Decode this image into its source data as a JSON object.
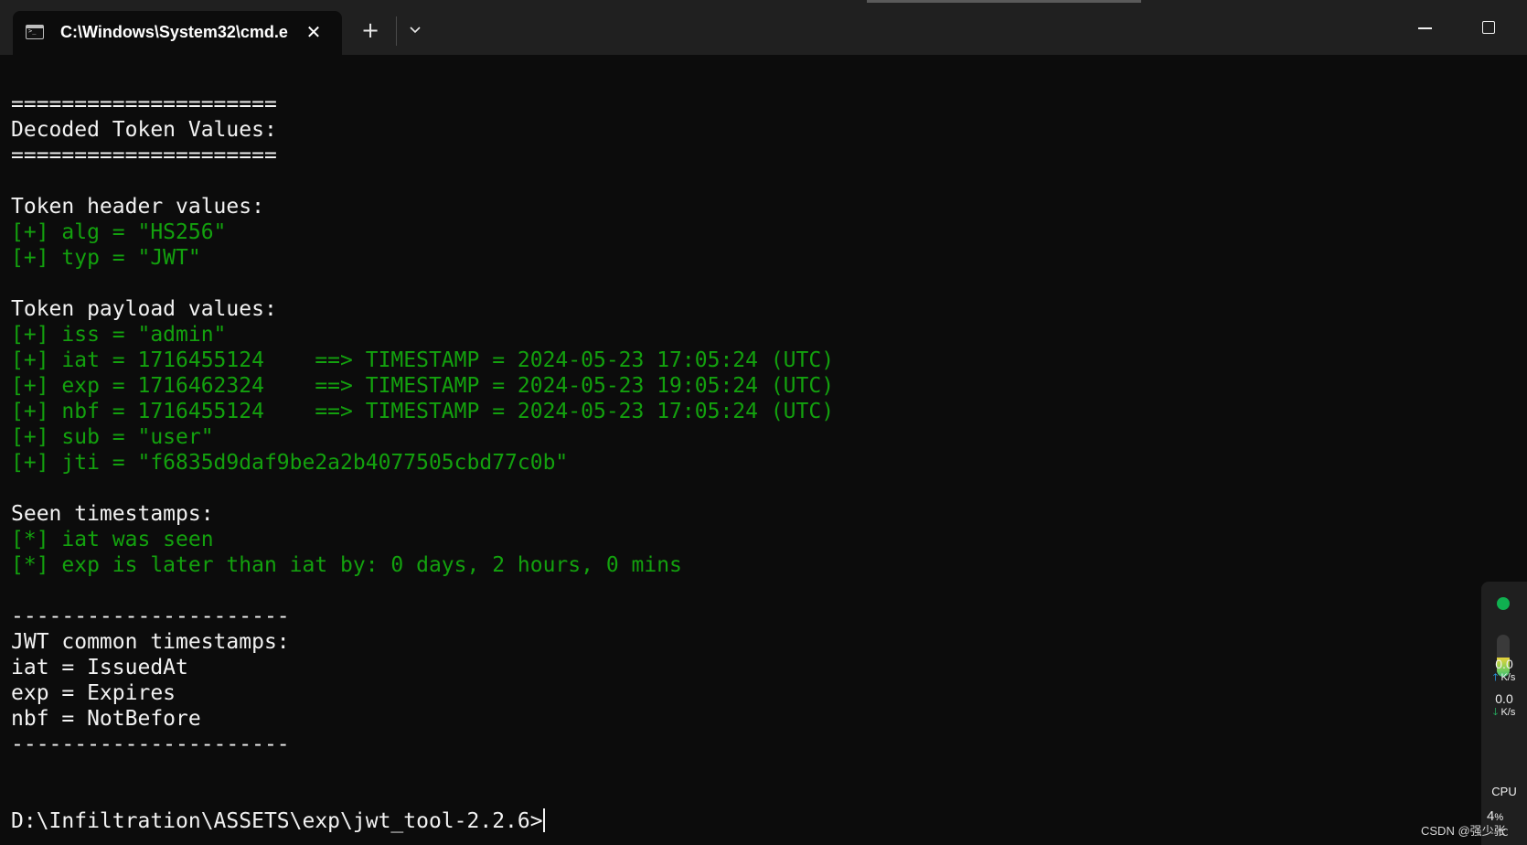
{
  "tab": {
    "title": "C:\\Windows\\System32\\cmd.e",
    "close_glyph": "✕",
    "new_tab_glyph": "+"
  },
  "terminal": {
    "lines": [
      {
        "text": "=====================",
        "color": "white"
      },
      {
        "text": "Decoded Token Values:",
        "color": "white"
      },
      {
        "text": "=====================",
        "color": "white"
      },
      {
        "text": "",
        "color": "white"
      },
      {
        "text": "Token header values:",
        "color": "white"
      },
      {
        "text": "[+] alg = \"HS256\"",
        "color": "green"
      },
      {
        "text": "[+] typ = \"JWT\"",
        "color": "green"
      },
      {
        "text": "",
        "color": "white"
      },
      {
        "text": "Token payload values:",
        "color": "white"
      },
      {
        "text": "[+] iss = \"admin\"",
        "color": "green"
      },
      {
        "text": "[+] iat = 1716455124    ==> TIMESTAMP = 2024-05-23 17:05:24 (UTC)",
        "color": "green"
      },
      {
        "text": "[+] exp = 1716462324    ==> TIMESTAMP = 2024-05-23 19:05:24 (UTC)",
        "color": "green"
      },
      {
        "text": "[+] nbf = 1716455124    ==> TIMESTAMP = 2024-05-23 17:05:24 (UTC)",
        "color": "green"
      },
      {
        "text": "[+] sub = \"user\"",
        "color": "green"
      },
      {
        "text": "[+] jti = \"f6835d9daf9be2a2b4077505cbd77c0b\"",
        "color": "green"
      },
      {
        "text": "",
        "color": "white"
      },
      {
        "text": "Seen timestamps:",
        "color": "white"
      },
      {
        "text": "[*] iat was seen",
        "color": "green"
      },
      {
        "text": "[*] exp is later than iat by: 0 days, 2 hours, 0 mins",
        "color": "green"
      },
      {
        "text": "",
        "color": "white"
      },
      {
        "text": "----------------------",
        "color": "white"
      },
      {
        "text": "JWT common timestamps:",
        "color": "white"
      },
      {
        "text": "iat = IssuedAt",
        "color": "white"
      },
      {
        "text": "exp = Expires",
        "color": "white"
      },
      {
        "text": "nbf = NotBefore",
        "color": "white"
      },
      {
        "text": "----------------------",
        "color": "white"
      }
    ],
    "prompt": "D:\\Infiltration\\ASSETS\\exp\\jwt_tool-2.2.6>"
  },
  "widget": {
    "upload_speed": "0.0",
    "upload_unit": "K/s",
    "download_speed": "0.0",
    "download_unit": "K/s",
    "cpu_label": "CPU",
    "cpu_value": "4",
    "cpu_unit": "%",
    "temperature": "--℃",
    "meter_level": 0.45
  },
  "watermark": "CSDN @强少张",
  "colors": {
    "background": "#0c0c0c",
    "titlebar": "#202020",
    "green": "#13a10e",
    "white": "#f2f2f2"
  }
}
